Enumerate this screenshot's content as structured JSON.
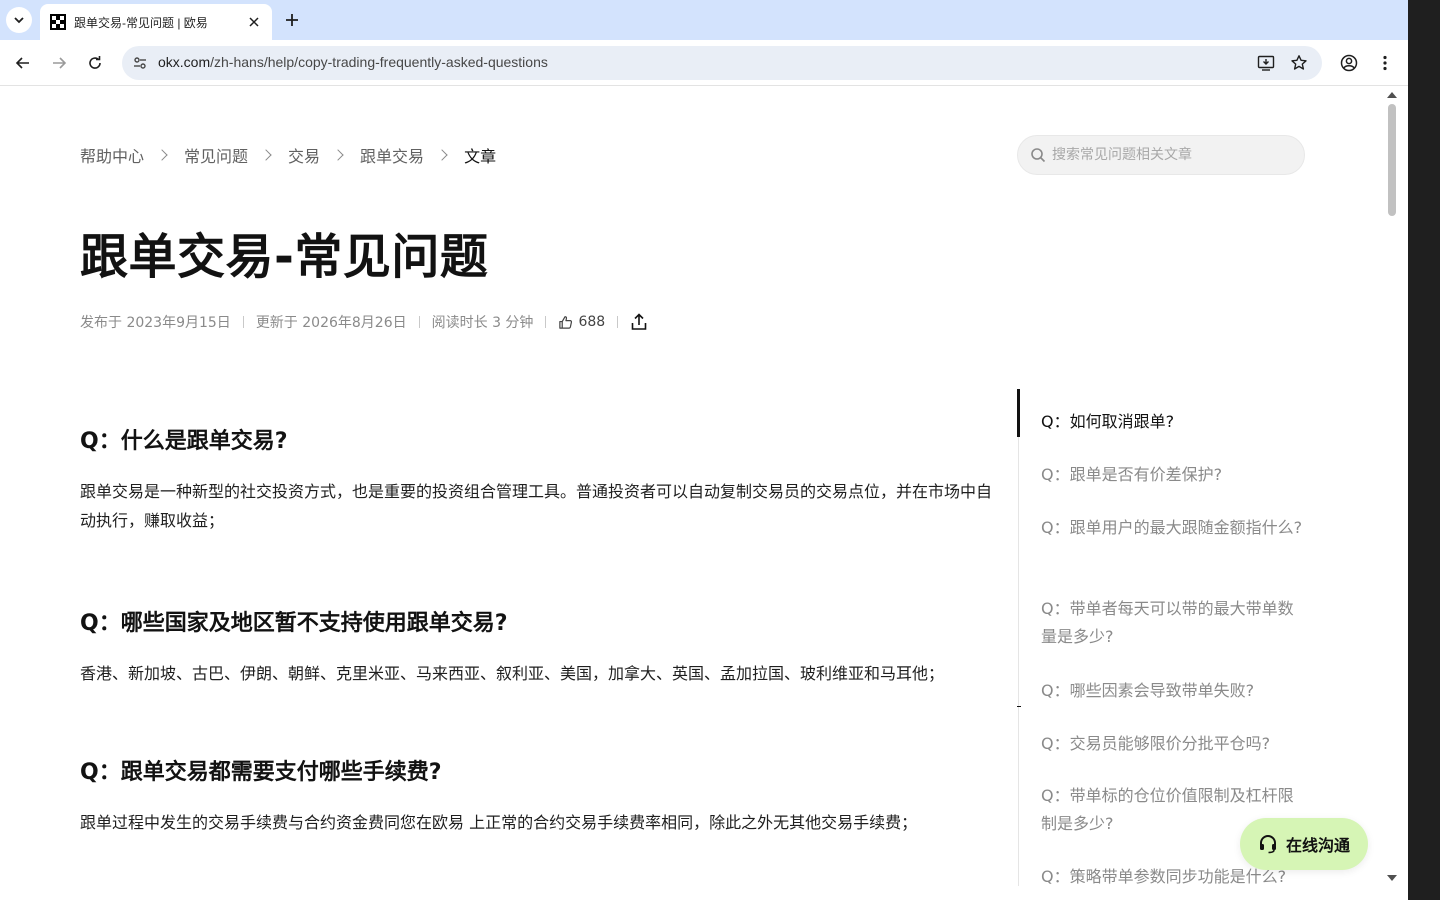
{
  "browser": {
    "tab_title": "跟单交易-常见问题 | 欧易",
    "url_host": "okx.com",
    "url_path": "/zh-hans/help/copy-trading-frequently-asked-questions"
  },
  "breadcrumb": [
    "帮助中心",
    "常见问题",
    "交易",
    "跟单交易",
    "文章"
  ],
  "search": {
    "placeholder": "搜索常见问题相关文章"
  },
  "title": "跟单交易-常见问题",
  "meta": {
    "published": "发布于 2023年9月15日",
    "updated": "更新于 2026年8月26日",
    "read_time": "阅读时长 3 分钟",
    "likes": "688"
  },
  "sections": [
    {
      "question": "Q：什么是跟单交易?",
      "answer": "跟单交易是一种新型的社交投资方式，也是重要的投资组合管理工具。普通投资者可以自动复制交易员的交易点位，并在市场中自动执行，赚取收益；"
    },
    {
      "question": "Q：哪些国家及地区暂不支持使用跟单交易?",
      "answer": "香港、新加坡、古巴、伊朗、朝鲜、克里米亚、马来西亚、叙利亚、美国，加拿大、英国、孟加拉国、玻利维亚和马耳他；"
    },
    {
      "question": "Q：跟单交易都需要支付哪些手续费?",
      "answer": "跟单过程中发生的交易手续费与合约资金费同您在欧易 上正常的合约交易手续费率相同，除此之外无其他交易手续费；"
    }
  ],
  "toc": [
    "Q：如何取消跟单?",
    "Q：跟单是否有价差保护?",
    "Q：跟单用户的最大跟随金额指什么?",
    "Q：带单者每天可以带的最大带单数量是多少?",
    "Q：哪些因素会导致带单失败?",
    "Q：交易员能够限价分批平仓吗?",
    "Q：带单标的仓位价值限制及杠杆限制是多少?",
    "Q：策略带单参数同步功能是什么?"
  ],
  "chat": {
    "label": "在线沟通"
  },
  "colors": {
    "chat_bg": "#d6f5b5",
    "text_primary": "#121212",
    "text_muted": "#8a8a8a",
    "tabstrip": "#d3e3fd"
  }
}
